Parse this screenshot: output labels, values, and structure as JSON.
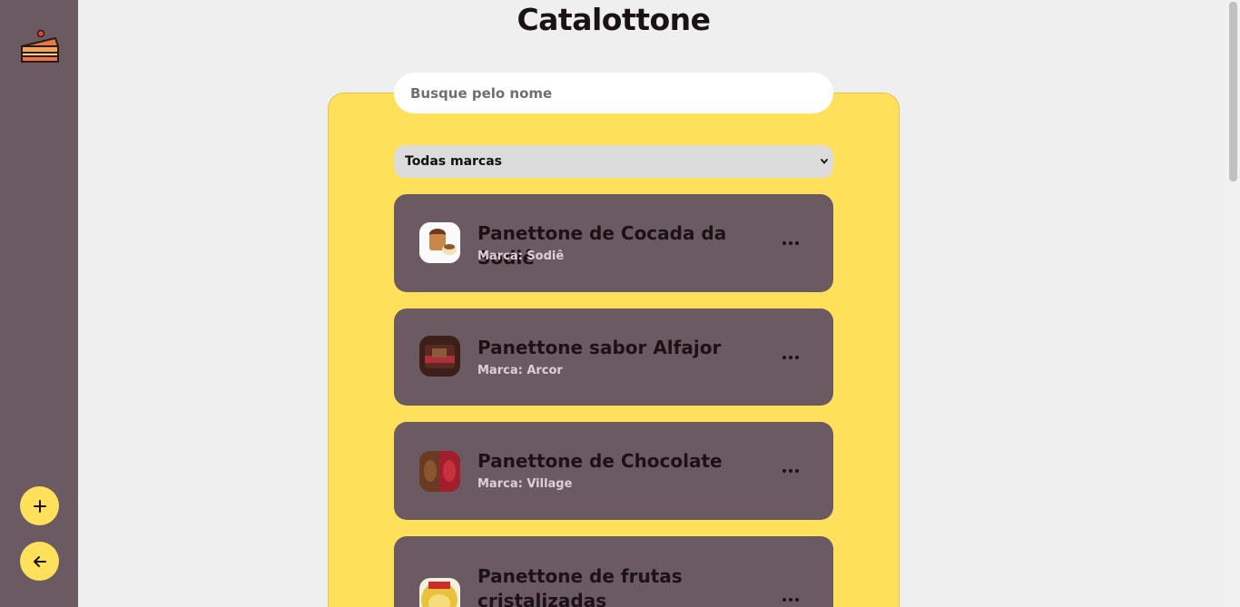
{
  "app": {
    "title": "Catalottone"
  },
  "sidebar": {
    "logo_icon": "cake-slice-icon",
    "add_icon": "plus-icon",
    "back_icon": "arrow-left-icon"
  },
  "search": {
    "placeholder": "Busque pelo nome",
    "value": ""
  },
  "filter": {
    "selected": "Todas marcas"
  },
  "products": [
    {
      "name": "Panettone de Cocada da Sodiê",
      "brand": "Marca: Sodiê"
    },
    {
      "name": "Panettone sabor Alfajor",
      "brand": "Marca: Arcor"
    },
    {
      "name": "Panettone de Chocolate",
      "brand": "Marca: Village"
    },
    {
      "name": "Panettone de frutas cristalizadas",
      "brand": ""
    }
  ],
  "colors": {
    "sidebar": "#6b5a62",
    "accent": "#ffe05a",
    "background": "#efefef",
    "card": "#6b5a62"
  }
}
